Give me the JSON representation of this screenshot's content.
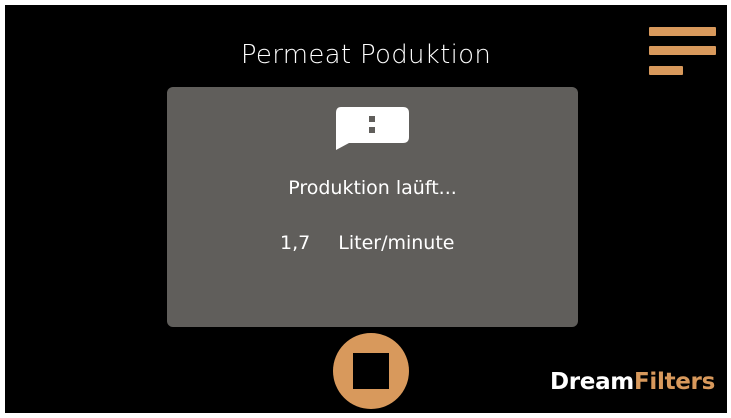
{
  "header": {
    "title": "Permeat Poduktion"
  },
  "menu": {
    "icon": "hamburger-menu-icon"
  },
  "status_card": {
    "icon": "message-alert-icon",
    "status_text": "Produktion laüft...",
    "flow_value": "1,7",
    "flow_unit": "Liter/minute"
  },
  "controls": {
    "stop_icon": "stop-icon"
  },
  "branding": {
    "logo_part1": "Dream",
    "logo_part2": "Filters"
  },
  "colors": {
    "background": "#000000",
    "accent": "#d8995c",
    "card": "#605e5b",
    "text": "#ffffff"
  }
}
